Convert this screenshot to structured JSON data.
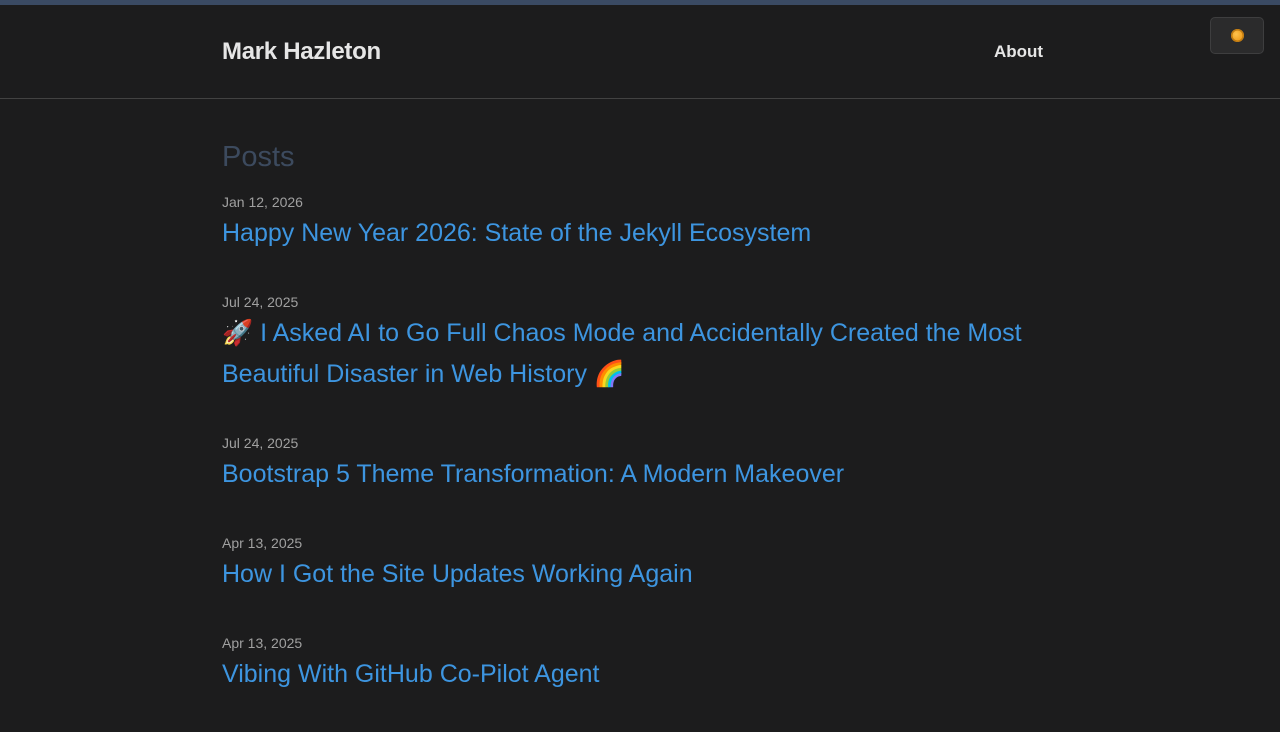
{
  "header": {
    "site_title": "Mark Hazleton",
    "nav_about": "About"
  },
  "theme_toggle": {
    "icon": "sun-icon",
    "icon_color": "#f0a020"
  },
  "main": {
    "heading": "Posts",
    "posts": [
      {
        "date": "Jan 12, 2026",
        "title": "Happy New Year 2026: State of the Jekyll Ecosystem"
      },
      {
        "date": "Jul 24, 2025",
        "title": "🚀 I Asked AI to Go Full Chaos Mode and Accidentally Created the Most Beautiful Disaster in Web History 🌈"
      },
      {
        "date": "Jul 24, 2025",
        "title": "Bootstrap 5 Theme Transformation: A Modern Makeover"
      },
      {
        "date": "Apr 13, 2025",
        "title": "How I Got the Site Updates Working Again"
      },
      {
        "date": "Apr 13, 2025",
        "title": "Vibing With GitHub Co-Pilot Agent"
      }
    ]
  },
  "colors": {
    "background": "#1c1c1d",
    "link": "#3d95e0",
    "top_bar": "#3a4a63"
  }
}
